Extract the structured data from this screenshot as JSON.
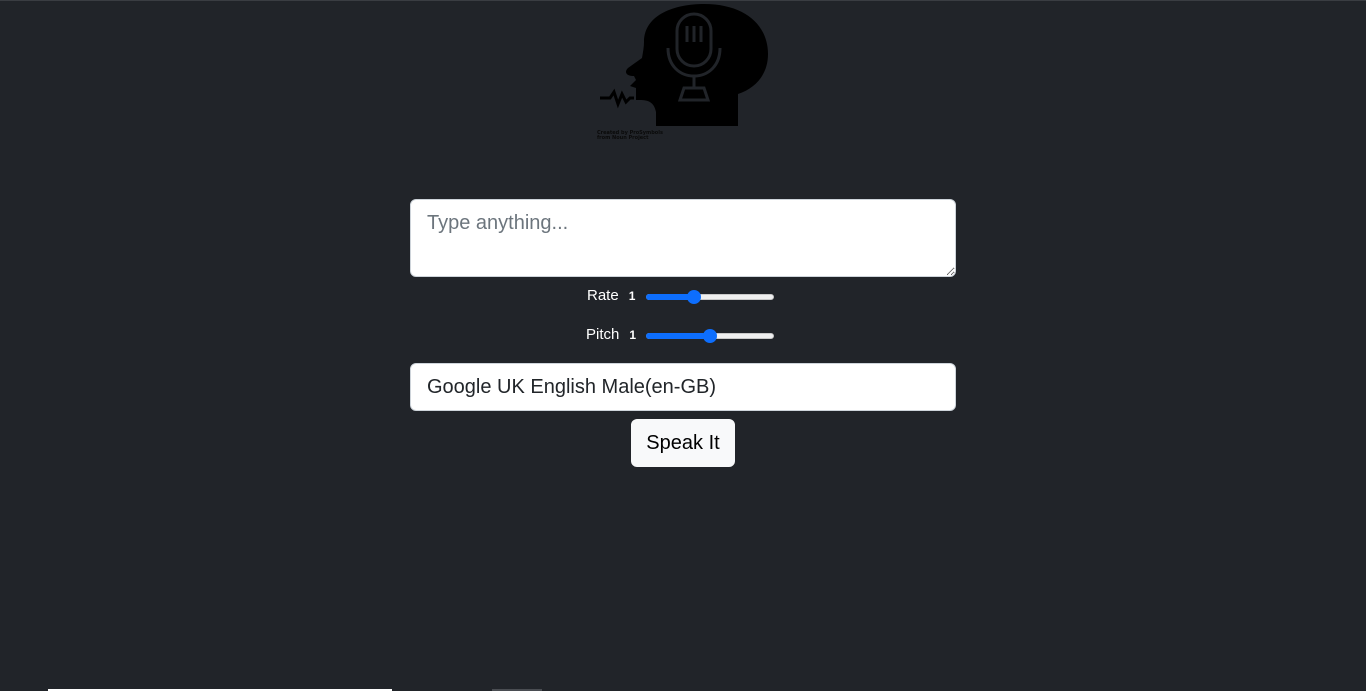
{
  "logo": {
    "icon": "speaking-head-microphone-icon",
    "credit_lines": "Created by ProSymbols\nfrom Noun Project"
  },
  "text_input": {
    "value": "",
    "placeholder": "Type anything..."
  },
  "rate": {
    "label": "Rate",
    "value": "1",
    "slider_fraction": 0.36
  },
  "pitch": {
    "label": "Pitch",
    "value": "1",
    "slider_fraction": 0.5
  },
  "voice_select": {
    "selected": "Google UK English Male(en-GB)"
  },
  "speak_button": {
    "label": "Speak It"
  },
  "colors": {
    "background": "#212429",
    "accent": "#0d6efd",
    "button_bg": "#f8f9fa"
  }
}
